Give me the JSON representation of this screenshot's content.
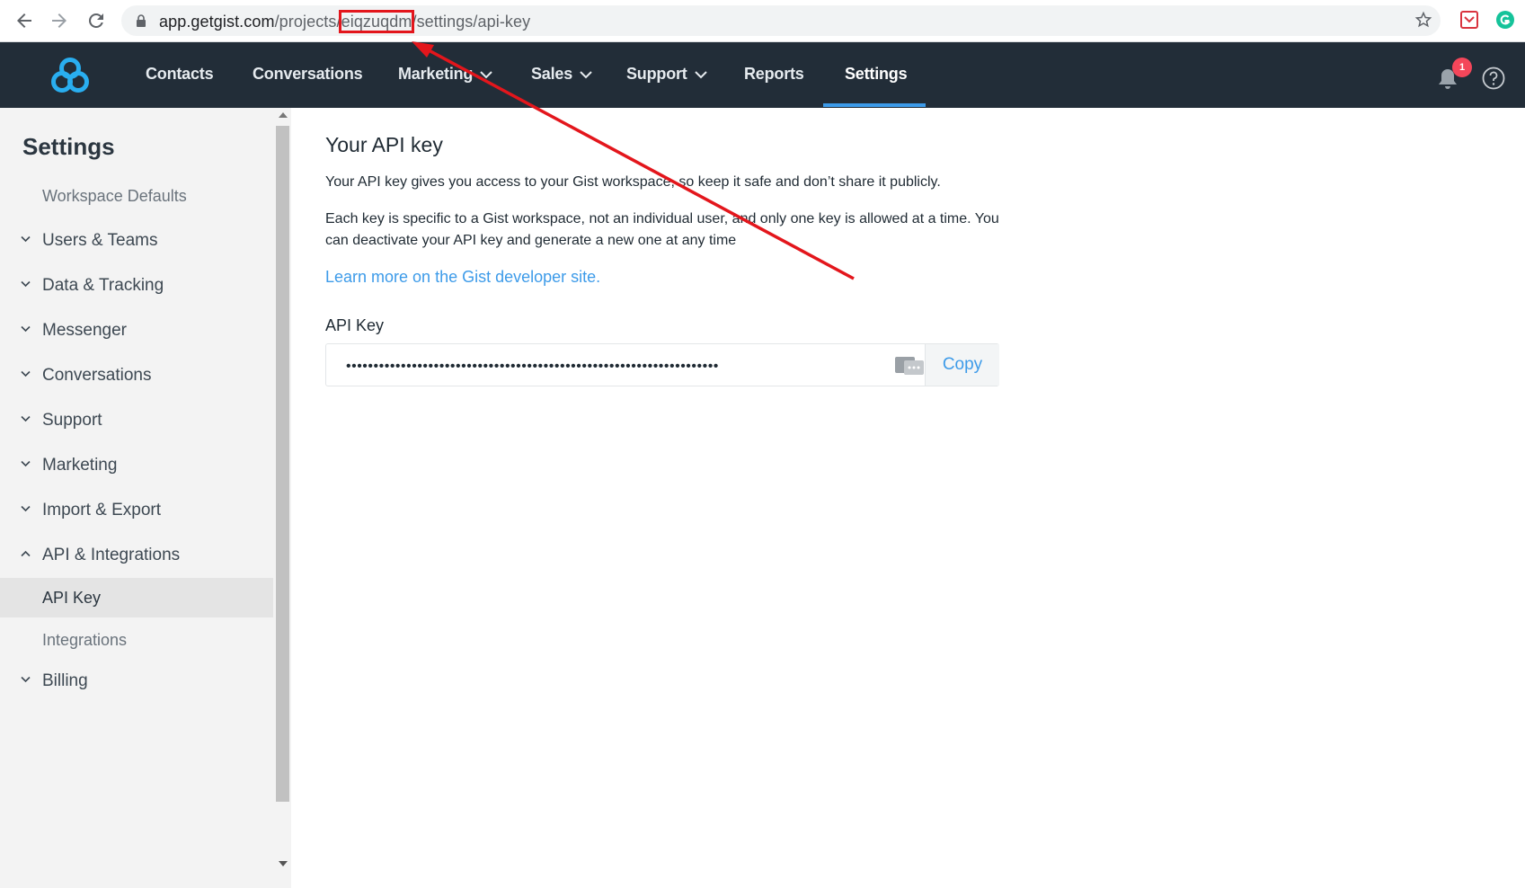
{
  "browser": {
    "url_host": "app.getgist.com",
    "url_path_before": "/projects/",
    "url_highlight": "eiqzuqdm",
    "url_path_after": "/settings/api-key",
    "annotation_color": "#e3161c"
  },
  "header": {
    "nav": [
      {
        "label": "Contacts"
      },
      {
        "label": "Conversations"
      },
      {
        "label": "Marketing"
      },
      {
        "label": "Sales"
      },
      {
        "label": "Support"
      },
      {
        "label": "Reports"
      },
      {
        "label": "Settings"
      }
    ],
    "notification_count": "1",
    "colors": {
      "background": "#222d38",
      "accent": "#3d9be9",
      "badge": "#f4465a"
    }
  },
  "sidebar": {
    "title": "Settings",
    "items": [
      {
        "label": "Workspace Defaults"
      },
      {
        "label": "Users & Teams"
      },
      {
        "label": "Data & Tracking"
      },
      {
        "label": "Messenger"
      },
      {
        "label": "Conversations"
      },
      {
        "label": "Support"
      },
      {
        "label": "Marketing"
      },
      {
        "label": "Import & Export"
      },
      {
        "label": "API & Integrations"
      },
      {
        "label": "API Key"
      },
      {
        "label": "Integrations"
      },
      {
        "label": "Billing"
      }
    ]
  },
  "main": {
    "title": "Your API key",
    "description": "Your API key gives you access to your Gist workspace, so keep it safe and don’t share it publicly.",
    "note_line1": "Each key is specific to a Gist workspace, not an individual user, and only one key is allowed at a time. You",
    "note_line2": "can deactivate your API key and generate a new one at any time",
    "link": "Learn more on the Gist developer site.",
    "api_key_label": "API Key",
    "api_key_masked": "••••••••••••••••••••••••••••••••••••••••••••••••••••••••••••••••••••",
    "copy_label": "Copy"
  }
}
